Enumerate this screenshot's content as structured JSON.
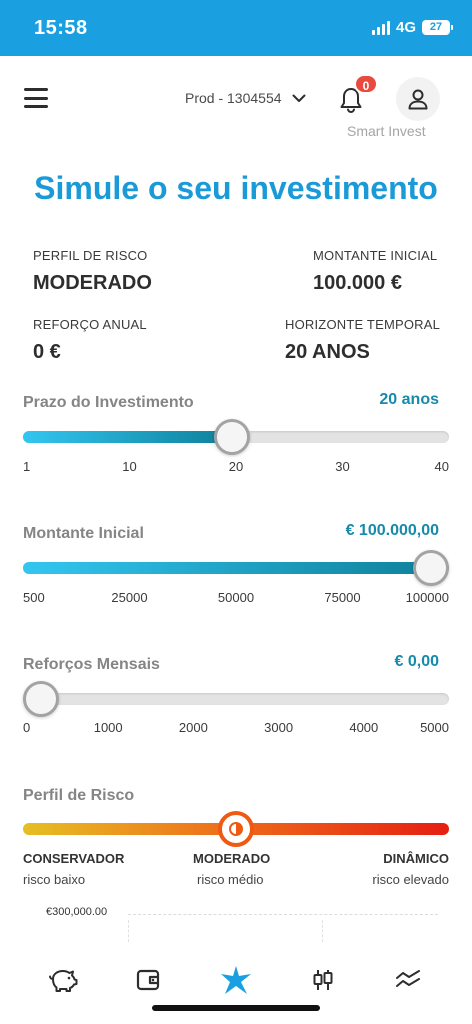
{
  "status": {
    "time": "15:58",
    "network": "4G",
    "battery": "27"
  },
  "header": {
    "account": "Prod - 1304554",
    "notifications": "0",
    "subtitle": "Smart Invest"
  },
  "title": "Simule o seu investimento",
  "summary": {
    "risk_label": "PERFIL DE RISCO",
    "risk_value": "MODERADO",
    "initial_label": "MONTANTE INICIAL",
    "initial_value": "100.000 €",
    "annual_label": "REFORÇO ANUAL",
    "annual_value": "0 €",
    "horizon_label": "HORIZONTE TEMPORAL",
    "horizon_value": "20 ANOS"
  },
  "sliders": {
    "term": {
      "label": "Prazo do Investimento",
      "value": "20 anos",
      "ticks": [
        "1",
        "10",
        "20",
        "30",
        "40"
      ],
      "level": 0.49
    },
    "initial": {
      "label": "Montante Inicial",
      "value": "€ 100.000,00",
      "ticks": [
        "500",
        "25000",
        "50000",
        "75000",
        "100000"
      ],
      "level": 1.0
    },
    "monthly": {
      "label": "Reforços Mensais",
      "value": "€ 0,00",
      "ticks": [
        "0",
        "1000",
        "2000",
        "3000",
        "4000",
        "5000"
      ],
      "level": 0.0
    }
  },
  "risk": {
    "label": "Perfil de Risco",
    "level": 0.5,
    "options": [
      {
        "name": "CONSERVADOR",
        "sub": "risco baixo"
      },
      {
        "name": "MODERADO",
        "sub": "risco médio"
      },
      {
        "name": "DINÂMICO",
        "sub": "risco elevado"
      }
    ]
  },
  "chart": {
    "top_value": "€300,000.00"
  },
  "colors": {
    "brand": "#1a9fe0",
    "accent": "#178aab",
    "badge": "#e94a3f",
    "risk_thumb": "#ee5a12"
  },
  "nav": [
    "piggy-bank-icon",
    "wallet-icon",
    "star-icon",
    "candlestick-icon",
    "trend-icon"
  ]
}
